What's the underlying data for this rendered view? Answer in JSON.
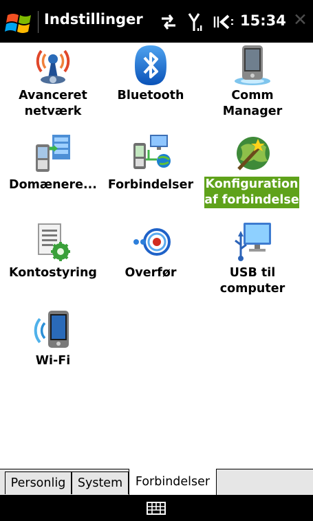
{
  "statusbar": {
    "title": "Indstillinger",
    "time": "15:34",
    "close_glyph": "✕",
    "icons": [
      "start-icon",
      "sync-icon",
      "signal-icon",
      "volume-icon"
    ]
  },
  "grid": {
    "items": [
      {
        "label": "Avanceret\nnetværk",
        "icon": "advanced-network-icon",
        "selected": false
      },
      {
        "label": "Bluetooth",
        "icon": "bluetooth-icon",
        "selected": false
      },
      {
        "label": "Comm\nManager",
        "icon": "comm-manager-icon",
        "selected": false
      },
      {
        "label": "Domænere...",
        "icon": "domain-enroll-icon",
        "selected": false
      },
      {
        "label": "Forbindelser",
        "icon": "connections-icon",
        "selected": false
      },
      {
        "label": "Konfiguration\naf forbindelse",
        "icon": "connection-setup-icon",
        "selected": true
      },
      {
        "label": "Kontostyring",
        "icon": "account-manager-icon",
        "selected": false
      },
      {
        "label": "Overfør",
        "icon": "beam-icon",
        "selected": false
      },
      {
        "label": "USB til\ncomputer",
        "icon": "usb-to-pc-icon",
        "selected": false
      },
      {
        "label": "Wi-Fi",
        "icon": "wifi-icon",
        "selected": false
      }
    ]
  },
  "tabs": [
    {
      "label": "Personlig",
      "active": false
    },
    {
      "label": "System",
      "active": false
    },
    {
      "label": "Forbindelser",
      "active": true
    }
  ],
  "softbar": {
    "icon": "keyboard-icon"
  },
  "colors": {
    "selection": "#5fa21a",
    "statusbar": "#000000",
    "tabbar": "#e6e6e6"
  }
}
